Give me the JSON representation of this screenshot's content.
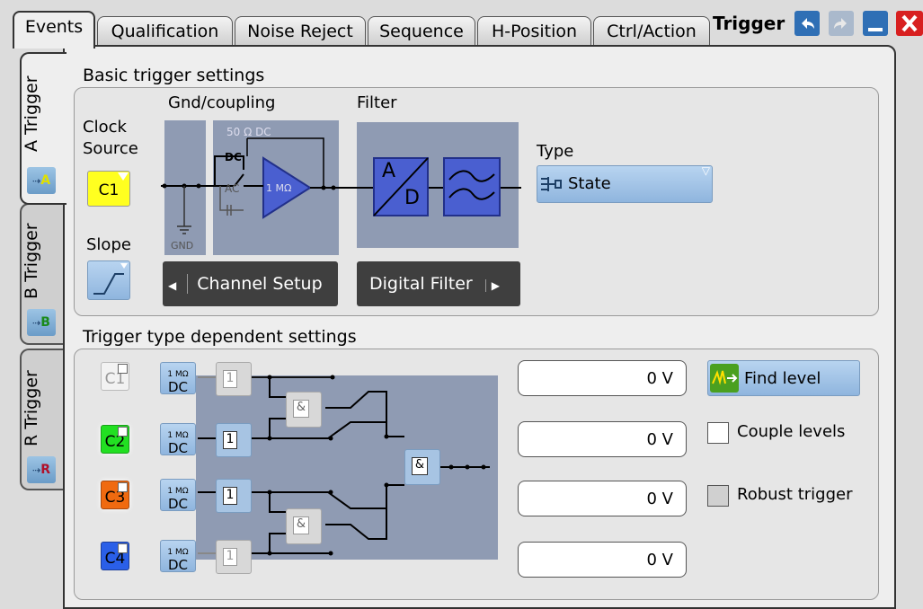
{
  "tabs": [
    "Events",
    "Qualification",
    "Noise Reject",
    "Sequence",
    "H-Position",
    "Ctrl/Action"
  ],
  "window_title": "Trigger",
  "side_tabs": [
    {
      "label": "A Trigger",
      "icon_letter": "A",
      "icon_color": "#e0e000"
    },
    {
      "label": "B Trigger",
      "icon_letter": "B",
      "icon_color": "#2a9a2a"
    },
    {
      "label": "R Trigger",
      "icon_letter": "R",
      "icon_color": "#b0102a"
    }
  ],
  "basic": {
    "title": "Basic trigger settings",
    "clock_source_label": "Clock\nSource",
    "clock_source_value": "C1",
    "slope_label": "Slope",
    "gnd_coupling_label": "Gnd/coupling",
    "filter_label": "Filter",
    "impedance_label": "50 Ω DC",
    "dc_label": "DC",
    "ac_label": "AC",
    "gnd_label": "GND",
    "mohm_label": "1 MΩ",
    "ad_label_a": "A",
    "ad_label_d": "D",
    "channel_setup_label": "Channel Setup",
    "digital_filter_label": "Digital Filter",
    "type_label": "Type",
    "type_value": "State"
  },
  "dependent": {
    "title": "Trigger type dependent settings",
    "channels": [
      {
        "label": "C1",
        "color": "#f2f2f2",
        "active": false
      },
      {
        "label": "C2",
        "color": "#22e022",
        "active": true
      },
      {
        "label": "C3",
        "color": "#f06a10",
        "active": true
      },
      {
        "label": "C4",
        "color": "#2a5fe8",
        "active": false
      }
    ],
    "coupling_top": "1 MΩ",
    "coupling_bottom": "DC",
    "logic_one": "1",
    "and_symbol": "&",
    "levels": [
      "0 V",
      "0 V",
      "0 V",
      "0 V"
    ],
    "find_level_label": "Find level",
    "couple_levels_label": "Couple levels",
    "robust_trigger_label": "Robust trigger"
  }
}
